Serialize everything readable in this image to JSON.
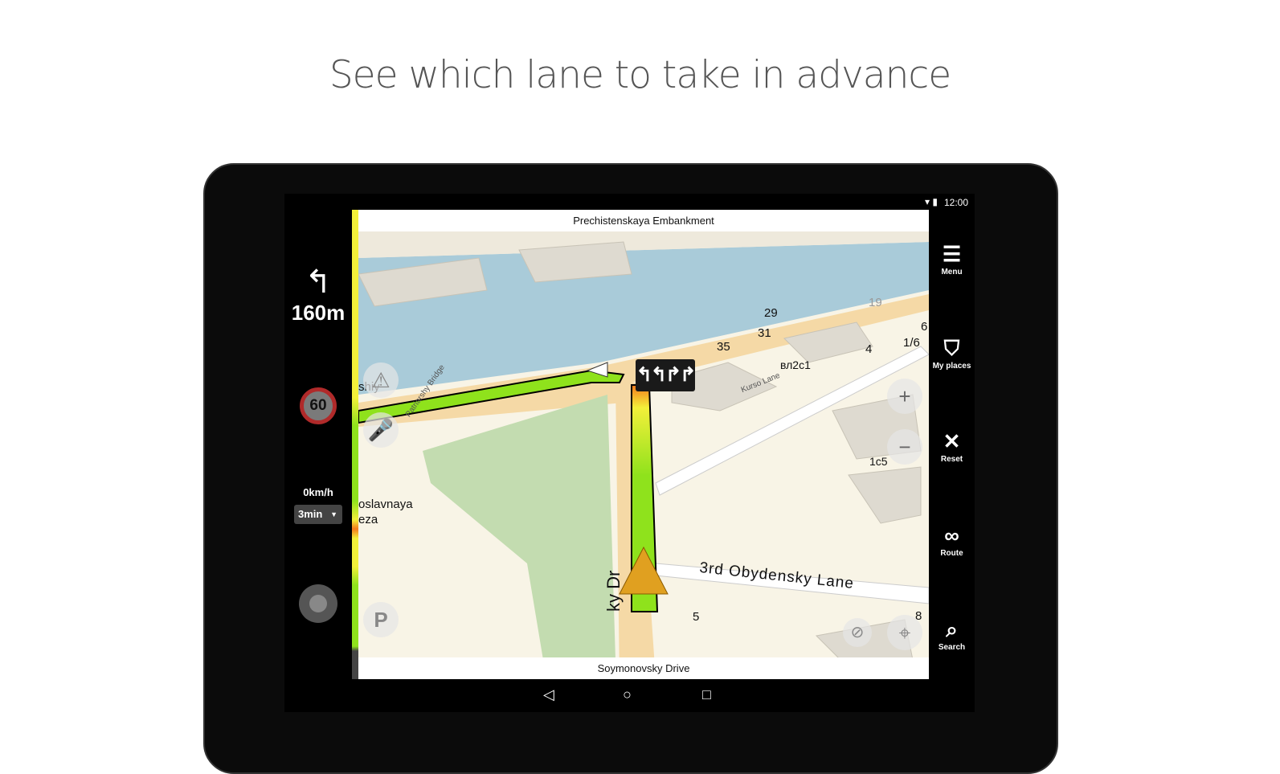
{
  "headline": "See which lane to take in advance",
  "status": {
    "time": "12:00",
    "icons": [
      "wifi-icon",
      "battery-icon"
    ]
  },
  "left_panel": {
    "maneuver_icon": "turn-left-arrow",
    "distance": "160m",
    "speed_limit": "60",
    "speed": "0km/h",
    "eta": "3min"
  },
  "map": {
    "top_street": "Prechistenskaya Embankment",
    "bottom_street": "Soymonovsky Drive",
    "lanes": "↰↰↱↱",
    "labels": [
      "29",
      "31",
      "35",
      "19",
      "4",
      "1/6",
      "6",
      "вл2с1",
      "1c5",
      "5",
      "8",
      "3rd Obydensky Lane",
      "oslavnaya",
      "eza",
      "shiy",
      "ky Dr",
      "Kurso Lane",
      "Patriarshy Bridge"
    ],
    "colors": {
      "water": "#a9cbd9",
      "park": "#c3dcb0",
      "route_green": "#8fe21c",
      "route_yellow": "#f3f03a",
      "road": "#f5d9a6"
    }
  },
  "right_panel": {
    "items": [
      {
        "label": "Menu",
        "icon": "menu-icon"
      },
      {
        "label": "My places",
        "icon": "bookmark-icon"
      },
      {
        "label": "Reset",
        "icon": "close-icon"
      },
      {
        "label": "Route",
        "icon": "route-icon"
      },
      {
        "label": "Search",
        "icon": "search-icon"
      }
    ]
  },
  "navbar": {
    "back": "◁",
    "home": "○",
    "recents": "□"
  }
}
